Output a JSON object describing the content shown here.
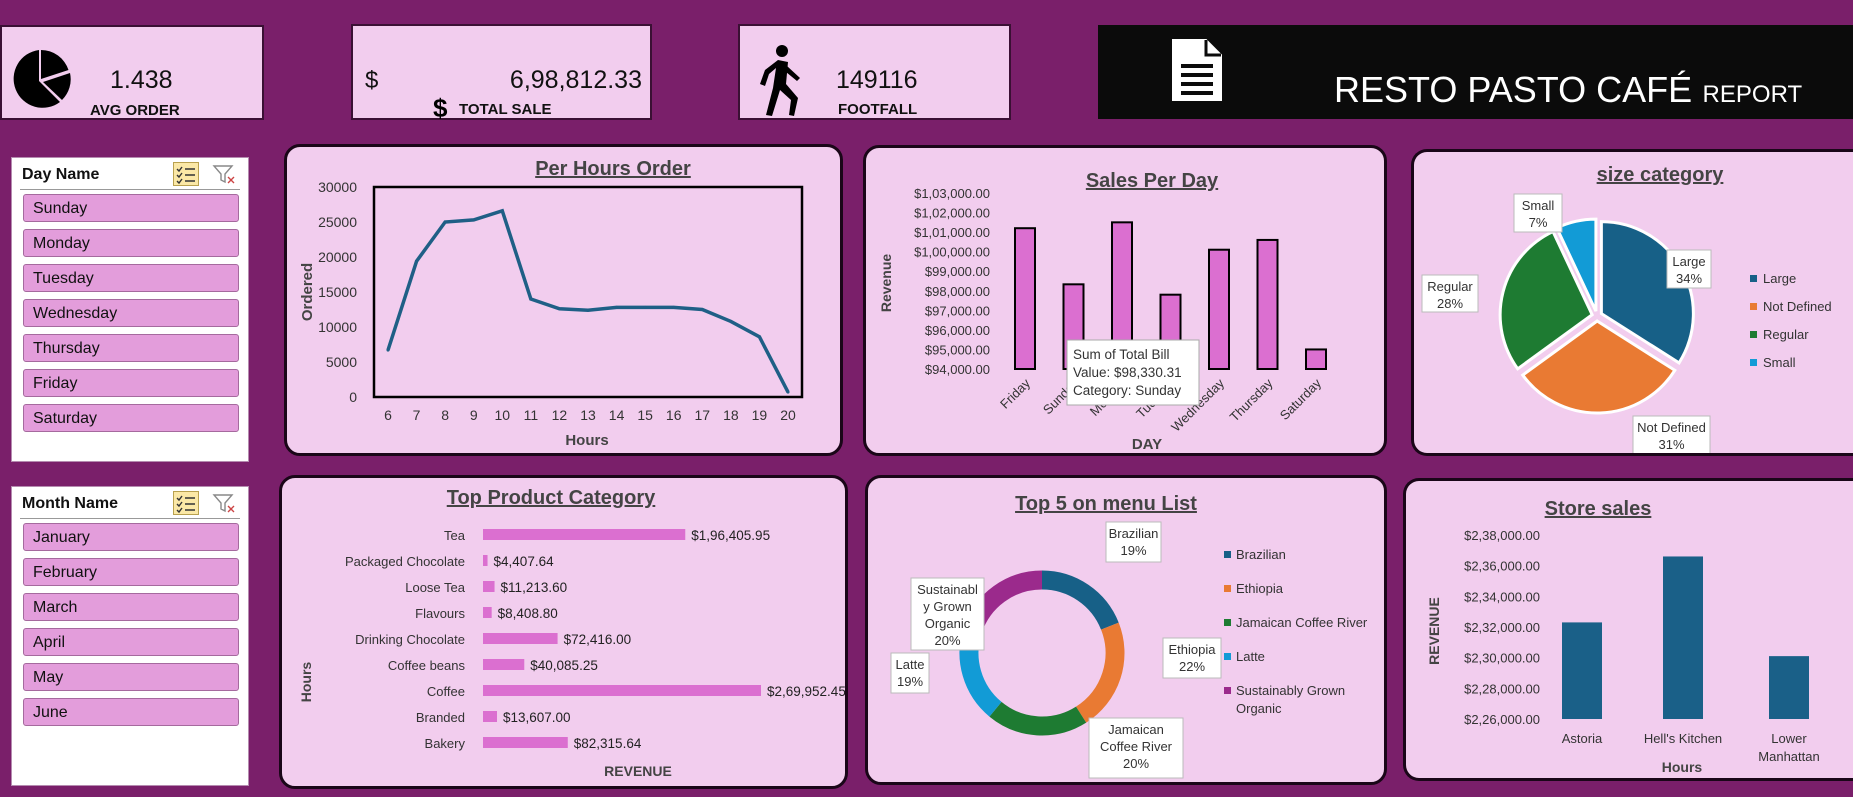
{
  "kpis": {
    "avg_order": {
      "value": "1.438",
      "label": "AVG ORDER"
    },
    "total_sale": {
      "currency": "$",
      "value": "6,98,812.33",
      "label": "TOTAL SALE"
    },
    "footfall": {
      "value": "149116",
      "label": "FOOTFALL"
    }
  },
  "banner": {
    "title": "RESTO PASTO CAFÉ",
    "suffix": "REPORT"
  },
  "slicers": {
    "day": {
      "title": "Day Name",
      "items": [
        "Sunday",
        "Monday",
        "Tuesday",
        "Wednesday",
        "Thursday",
        "Friday",
        "Saturday"
      ]
    },
    "month": {
      "title": "Month Name",
      "items": [
        "January",
        "February",
        "March",
        "April",
        "May",
        "June"
      ]
    }
  },
  "colors": {
    "background": "#7a1f6a",
    "panel": "#f2cdee",
    "line": "#1f5f86",
    "bar_pink": "#db6fd0",
    "bar_blue": "#1a6088",
    "large": "#176087",
    "not_defined": "#e97a33",
    "regular": "#1e7b32",
    "small": "#129bd6",
    "organic": "#9b2a8c"
  },
  "chart_data": [
    {
      "type": "line",
      "title": "Per Hours Order",
      "xlabel": "Hours",
      "ylabel": "Ordered",
      "x": [
        6,
        7,
        8,
        9,
        10,
        11,
        12,
        13,
        14,
        15,
        16,
        17,
        18,
        19,
        20
      ],
      "values": [
        6700,
        19400,
        25000,
        25300,
        26600,
        14000,
        12600,
        12400,
        12800,
        12800,
        12800,
        12500,
        10800,
        8600,
        700
      ],
      "ylim": [
        0,
        30000
      ],
      "yticks": [
        "0",
        "5000",
        "10000",
        "15000",
        "20000",
        "25000",
        "30000"
      ]
    },
    {
      "type": "bar",
      "title": "Sales Per Day",
      "xlabel": "DAY",
      "ylabel": "Revenue",
      "categories": [
        "Friday",
        "Sunday",
        "Monday",
        "Tuesday",
        "Wednesday",
        "Thursday",
        "Saturday"
      ],
      "values": [
        101200,
        98330.31,
        101500,
        97800,
        100100,
        100600,
        95000
      ],
      "ylim": [
        94000,
        103000
      ],
      "yticks": [
        "$94,000.00",
        "$95,000.00",
        "$96,000.00",
        "$97,000.00",
        "$98,000.00",
        "$99,000.00",
        "$1,00,000.00",
        "$1,01,000.00",
        "$1,02,000.00",
        "$1,03,000.00"
      ],
      "tooltip": {
        "line1": "Sum of Total Bill",
        "line2": "Value:  $98,330.31",
        "line3": "Category: Sunday"
      }
    },
    {
      "type": "pie",
      "title": "size category",
      "slices": [
        {
          "name": "Large",
          "value": 34,
          "label": "34%"
        },
        {
          "name": "Not Defined",
          "value": 31,
          "label": "31%"
        },
        {
          "name": "Regular",
          "value": 28,
          "label": "28%"
        },
        {
          "name": "Small",
          "value": 7,
          "label": "7%"
        }
      ],
      "legend": "right"
    },
    {
      "type": "bar",
      "orientation": "horizontal",
      "title": "Top Product Category",
      "xlabel": "REVENUE",
      "ylabel": "Hours",
      "categories": [
        "Tea",
        "Packaged Chocolate",
        "Loose Tea",
        "Flavours",
        "Drinking Chocolate",
        "Coffee beans",
        "Coffee",
        "Branded",
        "Bakery"
      ],
      "values": [
        196405.95,
        4407.64,
        11213.6,
        8408.8,
        72416.0,
        40085.25,
        269952.45,
        13607.0,
        82315.64
      ],
      "value_labels": [
        "$1,96,405.95",
        "$4,407.64",
        "$11,213.60",
        "$8,408.80",
        "$72,416.00",
        "$40,085.25",
        "$2,69,952.45",
        "$13,607.00",
        "$82,315.64"
      ]
    },
    {
      "type": "pie",
      "variant": "donut",
      "title": "Top 5 on menu List",
      "slices": [
        {
          "name": "Brazilian",
          "value": 19,
          "label": "19%"
        },
        {
          "name": "Ethiopia",
          "value": 22,
          "label": "22%"
        },
        {
          "name": "Jamaican Coffee River",
          "value": 20,
          "label": "20%"
        },
        {
          "name": "Latte",
          "value": 19,
          "label": "19%"
        },
        {
          "name": "Sustainably Grown Organic",
          "value": 20,
          "label": "20%"
        }
      ],
      "legend": "right"
    },
    {
      "type": "bar",
      "title": "Store sales",
      "xlabel": "Hours",
      "ylabel": "REVENUE",
      "categories": [
        "Astoria",
        "Hell's Kitchen",
        "Lower Manhattan"
      ],
      "values": [
        232300,
        236600,
        230100
      ],
      "ylim": [
        226000,
        238000
      ],
      "yticks": [
        "$2,26,000.00",
        "$2,28,000.00",
        "$2,30,000.00",
        "$2,32,000.00",
        "$2,34,000.00",
        "$2,36,000.00",
        "$2,38,000.00"
      ]
    }
  ]
}
